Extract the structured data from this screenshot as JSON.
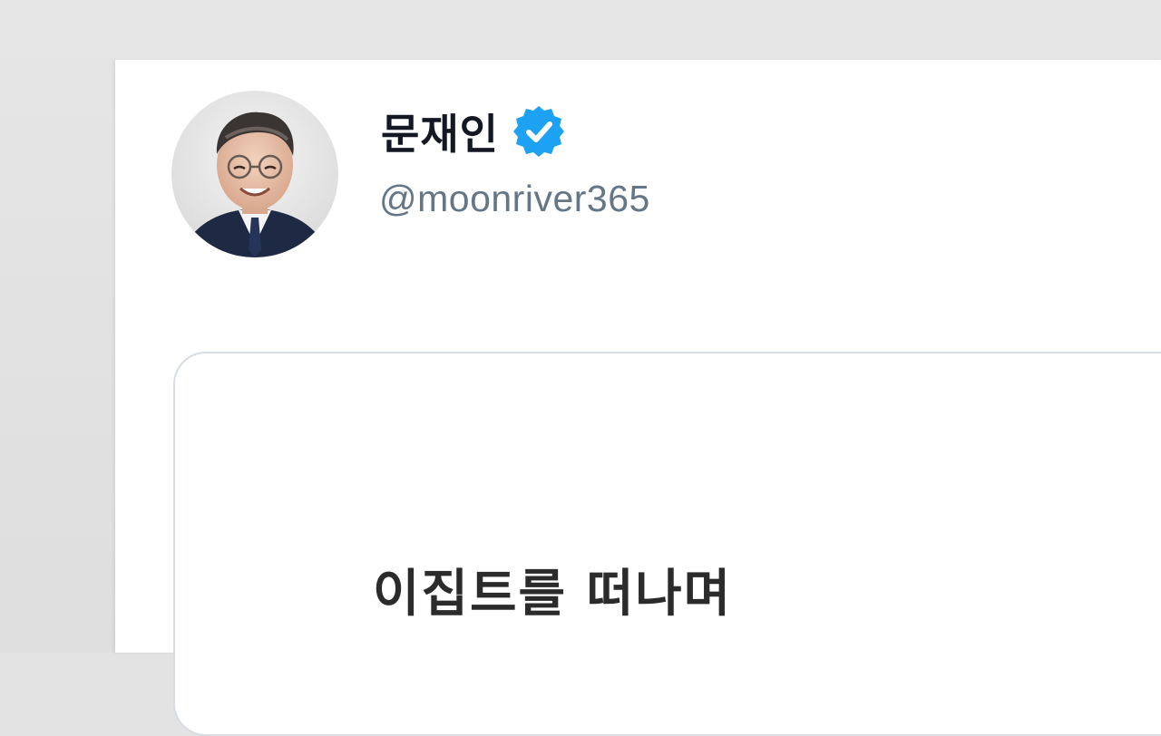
{
  "tweet": {
    "author": {
      "display_name": "문재인",
      "handle": "@moonriver365",
      "verified": true,
      "verified_icon": "verified-badge-icon",
      "verified_color": "#1da1f2"
    },
    "media_card": {
      "title": "이집트를 떠나며"
    }
  }
}
